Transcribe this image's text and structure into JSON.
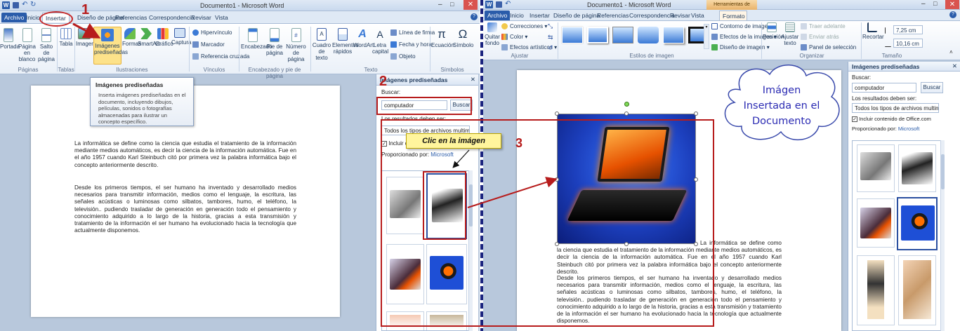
{
  "left": {
    "title": "Documento1 - Microsoft Word",
    "tabs": [
      "Archivo",
      "Inicio",
      "Insertar",
      "Diseño de página",
      "Referencias",
      "Correspondencia",
      "Revisar",
      "Vista"
    ],
    "groups": {
      "paginas": {
        "label": "Páginas",
        "buttons": [
          "Portada",
          "Página en blanco",
          "Salto de página"
        ]
      },
      "tablas": {
        "label": "Tablas",
        "buttons": [
          "Tabla"
        ]
      },
      "ilustraciones": {
        "label": "Ilustraciones",
        "buttons": [
          "Imagen",
          "Imágenes prediseñadas",
          "Formas",
          "SmartArt",
          "Gráfico",
          "Captura"
        ]
      },
      "vinculos": {
        "label": "Vínculos",
        "buttons": [
          "Hipervínculo",
          "Marcador",
          "Referencia cruzada"
        ]
      },
      "encabezado": {
        "label": "Encabezado y pie de página",
        "buttons": [
          "Encabezado",
          "Pie de página",
          "Número de página"
        ]
      },
      "texto": {
        "label": "Texto",
        "buttons": [
          "Cuadro de texto",
          "Elementos rápidos",
          "WordArt",
          "Letra capital"
        ],
        "small": [
          "Línea de firma",
          "Fecha y hora",
          "Objeto"
        ]
      },
      "simbolos": {
        "label": "Símbolos",
        "buttons": [
          "Ecuación",
          "Símbolo"
        ]
      }
    },
    "tooltip": {
      "title": "Imágenes prediseñadas",
      "body": "Inserta imágenes prediseñadas en el documento, incluyendo dibujos, películas, sonidos o fotografías almacenadas para ilustrar un concepto específico."
    },
    "pane": {
      "title": "Imágenes prediseñadas",
      "search_label": "Buscar:",
      "search_value": "computador",
      "search_button": "Buscar",
      "results_label": "Los resultados deben ser:",
      "results_value": "Todos los tipos de archivos multimedia",
      "include_label": "Incluir contenido de Office.com",
      "provider_label": "Proporcionado por:",
      "provider_value": "Microsoft"
    }
  },
  "document_text": {
    "para1": "La informática se define como la ciencia que estudia el tratamiento de la información mediante medios automáticos, es decir la ciencia de la información automática. Fue en el año 1957 cuando Karl Steinbuch citó por primera vez la palabra informática bajo el concepto anteriormente descrito.",
    "para2": "Desde los primeros tiempos, el ser humano ha inventado y desarrollado medios necesarios para transmitir información, medios como el lenguaje, la escritura, las señales acústicas o luminosas como silbatos, tambores, humo, el teléfono, la televisión.. pudiendo trasladar de generación en generación todo el pensamiento y conocimiento adquirido a lo largo de la historia, gracias a esta transmisión y tratamiento de la información el ser humano ha evolucionado hacia la tecnología que actualmente disponemos.",
    "wrapped_para1": "La informática se define como la ciencia que estudia el tratamiento de la información mediante medios automáticos, es decir la ciencia de la información automática. Fue en el año 1957 cuando Karl Steinbuch citó por primera vez la palabra informática bajo el concepto anteriormente descrito."
  },
  "right": {
    "title": "Documento1 - Microsoft Word",
    "context_tab": "Herramientas de imagen",
    "tabs": [
      "Archivo",
      "Inicio",
      "Insertar",
      "Diseño de página",
      "Referencias",
      "Correspondencia",
      "Revisar",
      "Vista",
      "Formato"
    ],
    "ajustar": {
      "label": "Ajustar",
      "buttons": [
        "Quitar fondo"
      ],
      "small": [
        "Correcciones",
        "Color",
        "Efectos artísticos"
      ]
    },
    "estilos": {
      "label": "Estilos de imagen",
      "small": [
        "Contorno de imagen",
        "Efectos de la imagen",
        "Diseño de imagen"
      ]
    },
    "organizar": {
      "label": "Organizar",
      "buttons": [
        "Posición",
        "Ajustar texto"
      ],
      "small": [
        "Traer adelante",
        "Enviar atrás",
        "Panel de selección"
      ]
    },
    "tamano": {
      "label": "Tamaño",
      "buttons": [
        "Recortar"
      ],
      "height": "7,25 cm",
      "width": "10,16 cm"
    },
    "pane": {
      "title": "Imágenes prediseñadas",
      "search_label": "Buscar:",
      "search_value": "computador",
      "search_button": "Buscar",
      "results_label": "Los resultados deben ser:",
      "results_value": "Todos los tipos de archivos multimedia",
      "include_label": "Incluir contenido de Office.com",
      "provider_label": "Proporcionado por:",
      "provider_value": "Microsoft"
    }
  },
  "annotations": {
    "step1": "1",
    "step2": "2",
    "step3": "3",
    "callout": "Clic en la imágen",
    "cloud_line1": "Imágen",
    "cloud_line2": "Insertada en el",
    "cloud_line3": "Documento"
  },
  "colors": {
    "annotation_red": "#b71c1c",
    "callout_yellow": "#fff59d",
    "cloud_text": "#2b2bb3",
    "divider": "#1a237e"
  }
}
